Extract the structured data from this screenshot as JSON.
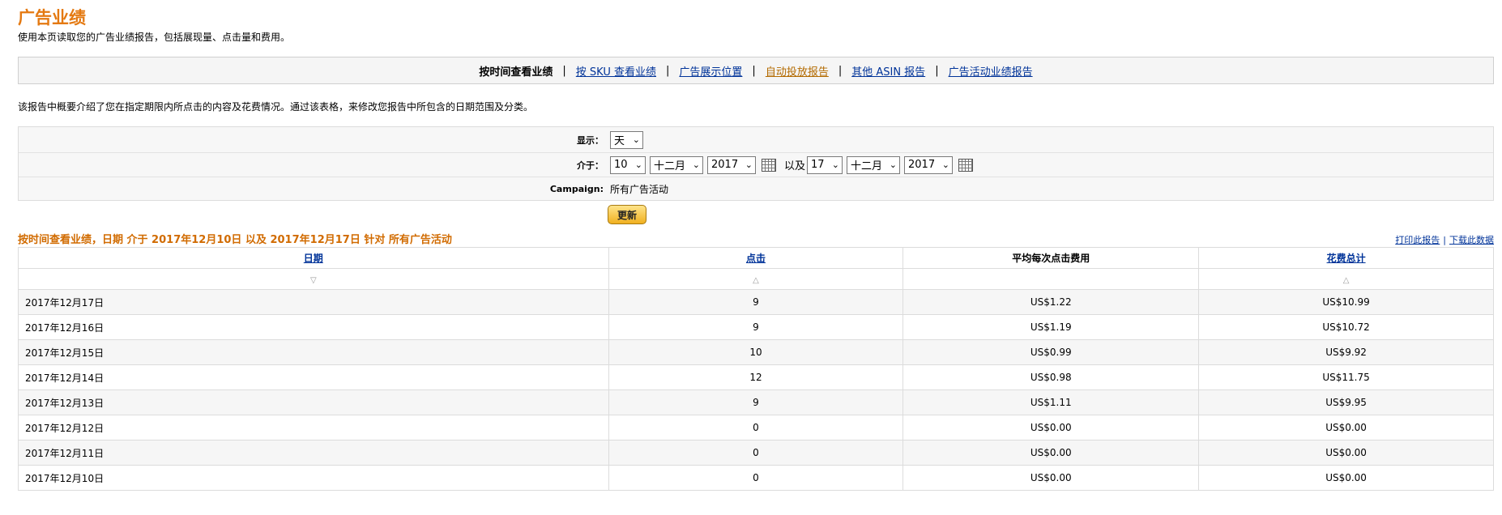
{
  "page": {
    "title": "广告业绩",
    "description": "使用本页读取您的广告业绩报告，包括展现量、点击量和费用。"
  },
  "nav": {
    "items": [
      {
        "label": "按时间查看业绩",
        "type": "current"
      },
      {
        "label": "按 SKU 查看业绩",
        "type": "link"
      },
      {
        "label": "广告展示位置",
        "type": "link"
      },
      {
        "label": "自动投放报告",
        "type": "visited"
      },
      {
        "label": "其他 ASIN 报告",
        "type": "link"
      },
      {
        "label": "广告活动业绩报告",
        "type": "link"
      }
    ],
    "separator": "|"
  },
  "report_description": "该报告中概要介绍了您在指定期限内所点击的内容及花费情况。通过该表格，来修改您报告中所包含的日期范围及分类。",
  "filter": {
    "display_label": "显示：",
    "display_value": "天",
    "range_label": "介于：",
    "from": {
      "day": "10",
      "month": "十二月",
      "year": "2017"
    },
    "and_text": "以及",
    "to": {
      "day": "17",
      "month": "十二月",
      "year": "2017"
    },
    "campaign_label": "Campaign:",
    "campaign_value": "所有广告活动"
  },
  "update_button": "更新",
  "result": {
    "heading": "按时间查看业绩，日期 介于 2017年12月10日 以及 2017年12月17日 针对 所有广告活动",
    "print_link": "打印此报告",
    "download_link": "下载此数据",
    "link_sep": "|"
  },
  "table": {
    "columns": [
      {
        "label": "日期",
        "link": true,
        "sort": "▽"
      },
      {
        "label": "点击",
        "link": true,
        "sort": "△"
      },
      {
        "label": "平均每次点击费用",
        "link": false,
        "sort": ""
      },
      {
        "label": "花费总计",
        "link": true,
        "sort": "△"
      }
    ],
    "rows": [
      {
        "date": "2017年12月17日",
        "clicks": "9",
        "cpc": "US$1.22",
        "spend": "US$10.99"
      },
      {
        "date": "2017年12月16日",
        "clicks": "9",
        "cpc": "US$1.19",
        "spend": "US$10.72"
      },
      {
        "date": "2017年12月15日",
        "clicks": "10",
        "cpc": "US$0.99",
        "spend": "US$9.92"
      },
      {
        "date": "2017年12月14日",
        "clicks": "12",
        "cpc": "US$0.98",
        "spend": "US$11.75"
      },
      {
        "date": "2017年12月13日",
        "clicks": "9",
        "cpc": "US$1.11",
        "spend": "US$9.95"
      },
      {
        "date": "2017年12月12日",
        "clicks": "0",
        "cpc": "US$0.00",
        "spend": "US$0.00"
      },
      {
        "date": "2017年12月11日",
        "clicks": "0",
        "cpc": "US$0.00",
        "spend": "US$0.00"
      },
      {
        "date": "2017年12月10日",
        "clicks": "0",
        "cpc": "US$0.00",
        "spend": "US$0.00"
      }
    ]
  },
  "colors": {
    "title": "#e47911",
    "heading": "#d16b00",
    "link": "#003399",
    "visited_link": "#b36a00"
  }
}
